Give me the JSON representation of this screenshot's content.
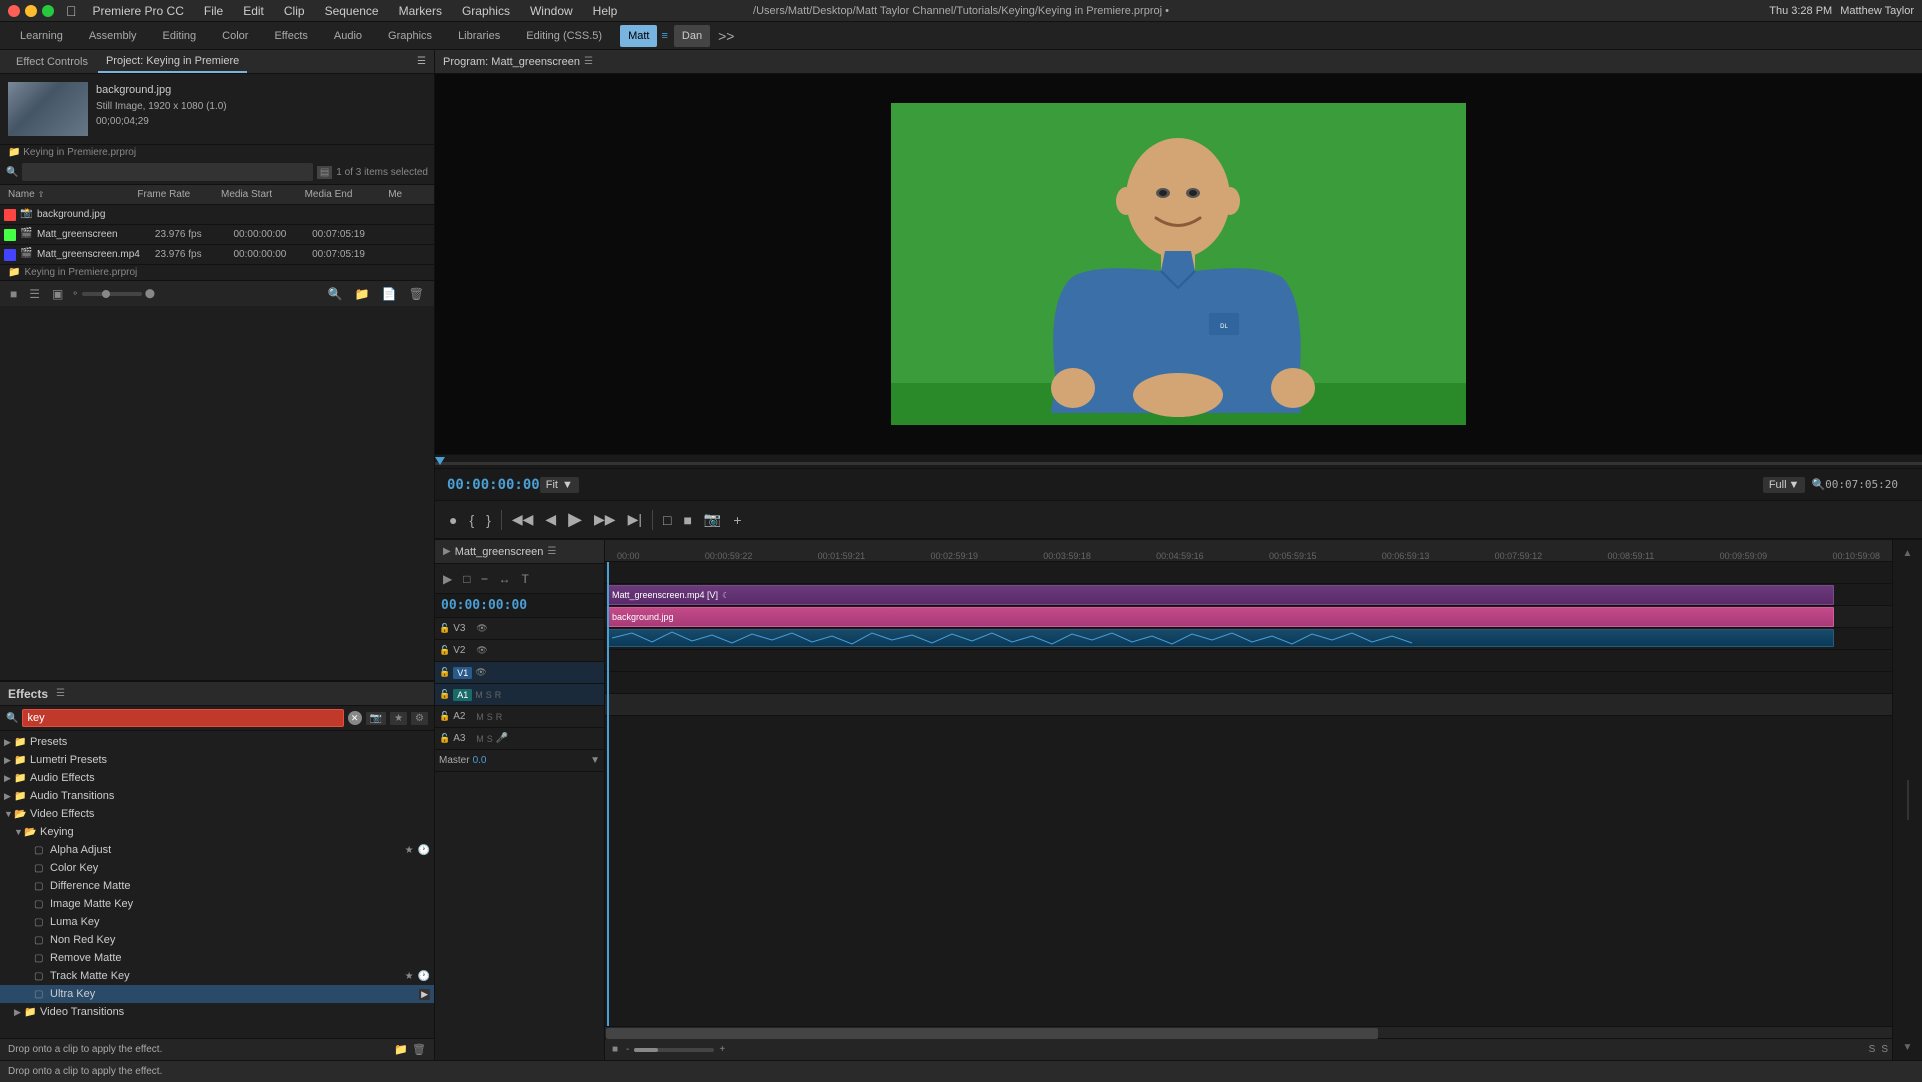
{
  "macbar": {
    "title": "/Users/Matt/Desktop/Matt Taylor Channel/Tutorials/Keying/Keying in Premiere.prproj •",
    "time": "Thu 3:28 PM",
    "user": "Matthew Taylor",
    "app_menus": [
      "Premiere Pro CC",
      "File",
      "Edit",
      "Clip",
      "Sequence",
      "Markers",
      "Graphics",
      "Window",
      "Help"
    ]
  },
  "workspace_tabs": {
    "tabs": [
      "Learning",
      "Assembly",
      "Editing",
      "Color",
      "Effects",
      "Audio",
      "Graphics",
      "Libraries",
      "Editing (CSS.5)"
    ],
    "active": "Matt",
    "user_tabs": [
      "Matt",
      "Dan"
    ],
    "more_label": ">>"
  },
  "left_panel": {
    "panel_tabs": [
      "Effect Controls",
      "Project: Keying in Premiere"
    ],
    "active_tab": "Project: Keying in Premiere",
    "project_title": "Project: Keying in Premiere",
    "thumbnail": {
      "filename": "background.jpg",
      "info1": "Still Image, 1920 x 1080 (1.0)",
      "info2": "00;00;04;29"
    },
    "sub_label": "Keying in Premiere.prproj",
    "search_placeholder": "",
    "search_value": "",
    "items_count": "1 of 3 items selected",
    "columns": [
      "Name",
      "Frame Rate",
      "Media Start",
      "Media End",
      "Me"
    ],
    "rows": [
      {
        "color": "#ff4444",
        "icon": "📷",
        "name": "background.jpg",
        "fps": "",
        "start": "",
        "end": "",
        "me": ""
      },
      {
        "color": "#44ff44",
        "icon": "🎬",
        "name": "Matt_greenscreen",
        "fps": "23.976 fps",
        "start": "00:00:00:00",
        "end": "00:07:05:19",
        "me": ""
      },
      {
        "color": "#4444ff",
        "icon": "🎬",
        "name": "Matt_greenscreen.mp4",
        "fps": "23.976 fps",
        "start": "00:00:00:00",
        "end": "00:07:05:19",
        "me": ""
      }
    ],
    "keying_label": "Keying in Premiere.prproj"
  },
  "effects_panel": {
    "title": "Effects",
    "search_value": "key",
    "tree_items": [
      {
        "level": 0,
        "type": "folder",
        "expanded": false,
        "label": "Presets"
      },
      {
        "level": 0,
        "type": "folder",
        "expanded": false,
        "label": "Lumetri Presets"
      },
      {
        "level": 0,
        "type": "folder",
        "expanded": false,
        "label": "Audio Effects"
      },
      {
        "level": 0,
        "type": "folder",
        "expanded": false,
        "label": "Audio Transitions"
      },
      {
        "level": 0,
        "type": "folder",
        "expanded": true,
        "label": "Video Effects"
      },
      {
        "level": 1,
        "type": "folder",
        "expanded": true,
        "label": "Keying"
      },
      {
        "level": 2,
        "type": "item",
        "label": "Alpha Adjust",
        "extras": true
      },
      {
        "level": 2,
        "type": "item",
        "label": "Color Key"
      },
      {
        "level": 2,
        "type": "item",
        "label": "Difference Matte"
      },
      {
        "level": 2,
        "type": "item",
        "label": "Image Matte Key"
      },
      {
        "level": 2,
        "type": "item",
        "label": "Luma Key"
      },
      {
        "level": 2,
        "type": "item",
        "label": "Non Red Key"
      },
      {
        "level": 2,
        "type": "item",
        "label": "Remove Matte"
      },
      {
        "level": 2,
        "type": "item",
        "label": "Track Matte Key",
        "extras": true
      },
      {
        "level": 2,
        "type": "item",
        "label": "Ultra Key",
        "selected": true,
        "has_icon": true
      },
      {
        "level": 1,
        "type": "folder",
        "expanded": false,
        "label": "Video Transitions"
      }
    ],
    "drop_label": "Drop onto a clip to apply the effect."
  },
  "program_monitor": {
    "title": "Program: Matt_greenscreen",
    "timecode": "00:00:00:00",
    "fit_label": "Fit",
    "full_label": "Full",
    "total_time": "00:07:05:20"
  },
  "timeline": {
    "title": "Matt_greenscreen",
    "timecode": "00:00:00:00",
    "ruler_marks": [
      "00:00",
      "00:00:59:22",
      "00:01:59:21",
      "00:02:59:19",
      "00:03:59:18",
      "00:04:59:16",
      "00:05:59:15",
      "00:06:59:13",
      "00:07:59:12",
      "00:08:59:11",
      "00:09:59:09",
      "00:10:59:08"
    ],
    "tracks": [
      {
        "name": "V3",
        "type": "video"
      },
      {
        "name": "V2",
        "type": "video"
      },
      {
        "name": "V1",
        "type": "video",
        "active": true
      },
      {
        "name": "A1",
        "type": "audio",
        "active": true
      },
      {
        "name": "A2",
        "type": "audio"
      },
      {
        "name": "A3",
        "type": "audio"
      }
    ],
    "master_label": "Master",
    "master_value": "0.0",
    "clips": [
      {
        "track": "V2",
        "label": "Matt_greenscreen.mp4 [V]",
        "type": "video"
      },
      {
        "track": "V1",
        "label": "background.jpg",
        "type": "image"
      },
      {
        "track": "A1",
        "label": "",
        "type": "audio"
      }
    ]
  }
}
